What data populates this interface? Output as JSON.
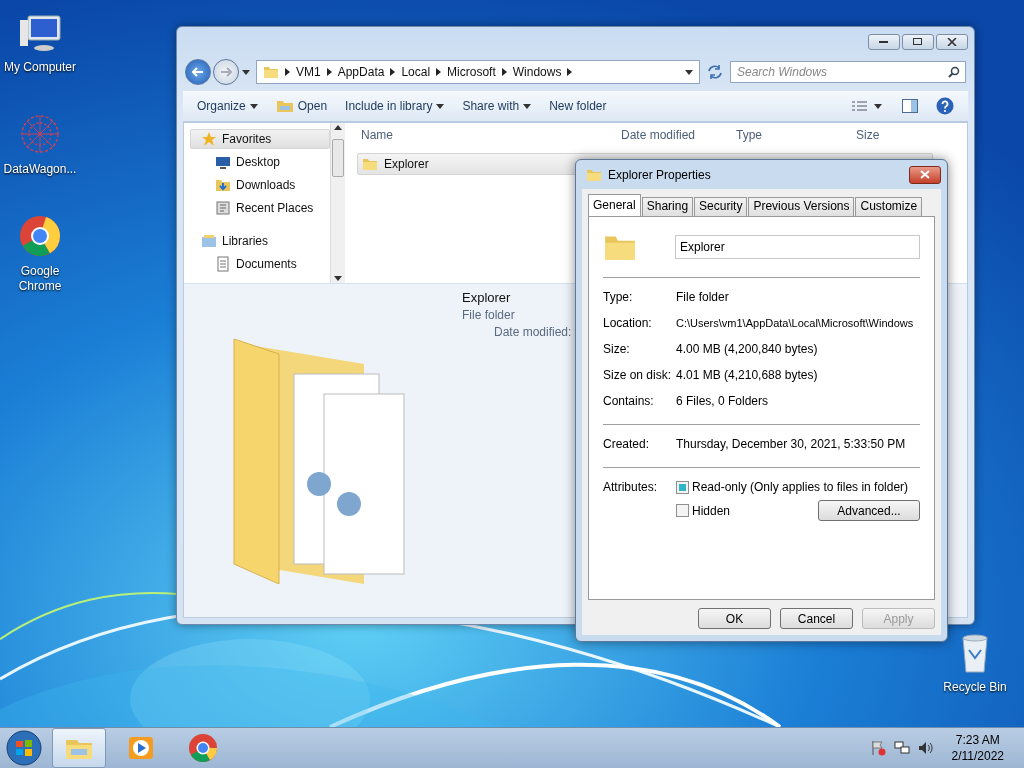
{
  "desktop_icons": [
    {
      "kind": "computer",
      "label": "My Computer"
    },
    {
      "kind": "web",
      "label": "DataWagon..."
    },
    {
      "kind": "chrome",
      "label": "Google Chrome"
    },
    {
      "kind": "bin",
      "label": "Recycle Bin"
    }
  ],
  "explorer": {
    "breadcrumb": [
      "VM1",
      "AppData",
      "Local",
      "Microsoft",
      "Windows"
    ],
    "search": {
      "placeholder": "Search Windows"
    },
    "commands": [
      {
        "label": "Organize",
        "dropdown": true,
        "kind": "text"
      },
      {
        "label": "Open",
        "dropdown": false,
        "kind": "open"
      },
      {
        "label": "Include in library",
        "dropdown": true,
        "kind": "text"
      },
      {
        "label": "Share with",
        "dropdown": true,
        "kind": "text"
      },
      {
        "label": "New folder",
        "dropdown": false,
        "kind": "text"
      }
    ],
    "nav": [
      {
        "label": "Favorites",
        "kind": "star",
        "selected": true,
        "children": [
          {
            "label": "Desktop",
            "kind": "desktop",
            "selected": false
          },
          {
            "label": "Downloads",
            "kind": "downloads",
            "selected": false
          },
          {
            "label": "Recent Places",
            "kind": "recent",
            "selected": false
          }
        ]
      },
      {
        "label": "Libraries",
        "kind": "library",
        "selected": false,
        "children": [
          {
            "label": "Documents",
            "kind": "documents",
            "selected": false
          }
        ]
      }
    ],
    "columns": [
      "Name",
      "Date modified",
      "Type",
      "Size"
    ],
    "rows": [
      {
        "name": "Explorer",
        "selected": true
      }
    ],
    "details": {
      "name": "Explorer",
      "type": "File folder",
      "date_label": "Date modified:"
    }
  },
  "dialog": {
    "title": "Explorer Properties",
    "tabs": [
      {
        "label": "General",
        "selected": true
      },
      {
        "label": "Sharing",
        "selected": false
      },
      {
        "label": "Security",
        "selected": false
      },
      {
        "label": "Previous Versions",
        "selected": false
      },
      {
        "label": "Customize",
        "selected": false
      }
    ],
    "name_value": "Explorer",
    "sections": [
      [
        {
          "label": "Type:",
          "value": "File folder"
        },
        {
          "label": "Location:",
          "value": "C:\\Users\\vm1\\AppData\\Local\\Microsoft\\Windows"
        },
        {
          "label": "Size:",
          "value": "4.00 MB (4,200,840 bytes)"
        },
        {
          "label": "Size on disk:",
          "value": "4.01 MB (4,210,688 bytes)"
        },
        {
          "label": "Contains:",
          "value": "6 Files, 0 Folders"
        }
      ],
      [
        {
          "label": "Created:",
          "value": "Thursday, December 30, 2021, 5:33:50 PM"
        }
      ]
    ],
    "attributes_label": "Attributes:",
    "attributes": [
      {
        "label": "Read-only (Only applies to files in folder)",
        "indeterminate": true
      },
      {
        "label": "Hidden",
        "indeterminate": false
      }
    ],
    "advanced": "Advanced...",
    "buttons": [
      {
        "label": "OK",
        "disabled": false
      },
      {
        "label": "Cancel",
        "disabled": false
      },
      {
        "label": "Apply",
        "disabled": true
      }
    ]
  },
  "taskbar": {
    "items": [
      {
        "kind": "explorer",
        "active": true
      },
      {
        "kind": "media",
        "active": false
      },
      {
        "kind": "chrome",
        "active": false
      }
    ],
    "time": "7:23 AM",
    "date": "2/11/2022"
  }
}
